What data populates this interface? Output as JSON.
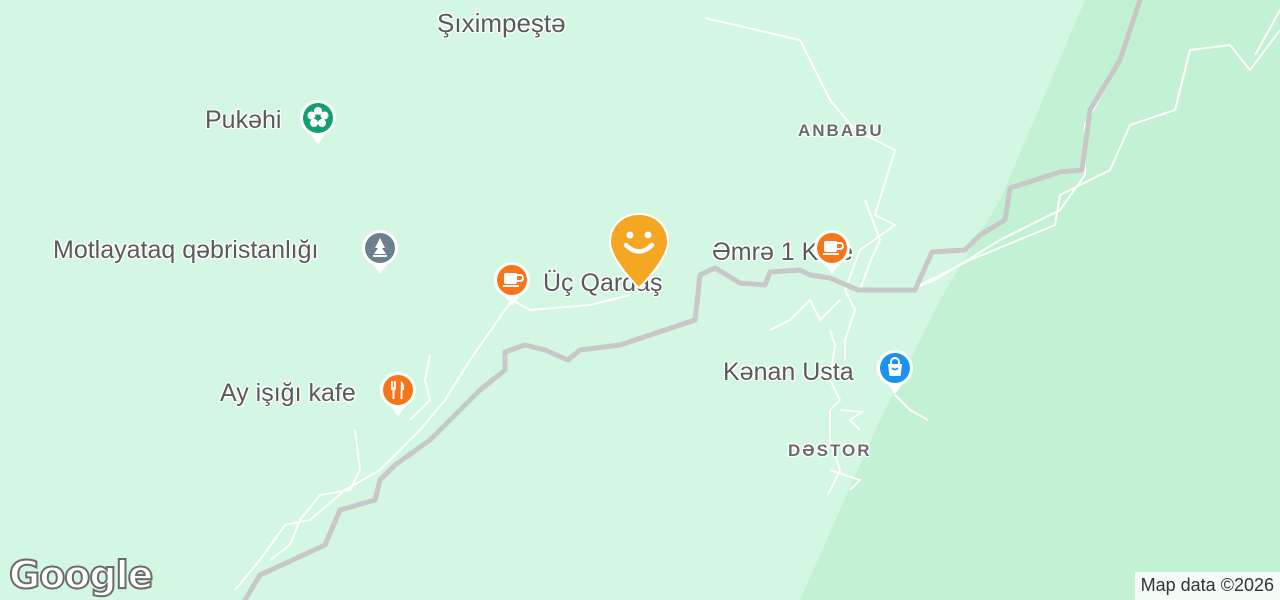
{
  "map": {
    "places": {
      "shiximpeshte": "Şıximpeştə",
      "pukehi": "Pukəhi",
      "motlayataq": "Motlayataq qəbristanlığı",
      "uc_qardas": "Üç Qardaş",
      "ay_isigi": "Ay işığı kafe",
      "emre_kafe": "Əmrə 1 Kafe",
      "kenan_usta": "Kənan Usta",
      "anbabu": "ANBABU",
      "destor": "DƏSTOR"
    },
    "colors": {
      "land": "#d3f7e2",
      "forest": "#c2f0d3",
      "road": "#c8c8c8",
      "path": "#ffffff",
      "food_pin": "#f5761a",
      "park_pin": "#119e70",
      "cemetery_pin": "#6b7f8e",
      "shop_pin": "#1a92f0",
      "current_marker": "#f5a623"
    },
    "icons": {
      "pukehi": "flower-icon",
      "motlayataq": "cemetery-icon",
      "uc_qardas": "coffee-icon",
      "ay_isigi": "restaurant-icon",
      "emre_kafe": "coffee-icon",
      "kenan_usta": "shopping-bag-icon",
      "marker": "smiley-marker-icon"
    }
  },
  "brand": {
    "logo_text": "Google"
  },
  "attribution": {
    "text": "Map data ©2026"
  }
}
